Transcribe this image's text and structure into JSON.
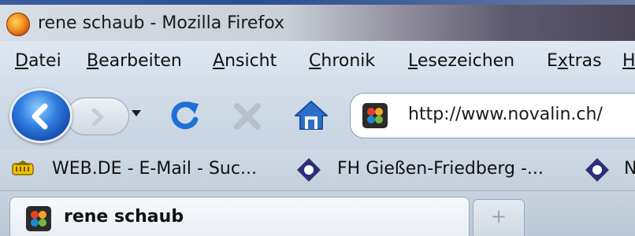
{
  "window": {
    "title": "rene schaub - Mozilla Firefox"
  },
  "menu": [
    {
      "accel": "D",
      "rest": "atei"
    },
    {
      "accel": "B",
      "rest": "earbeiten"
    },
    {
      "accel": "A",
      "rest": "nsicht"
    },
    {
      "accel": "C",
      "rest": "hronik"
    },
    {
      "accel": "L",
      "rest": "esezeichen"
    },
    {
      "pre": "E",
      "accel": "x",
      "rest": "tras"
    },
    {
      "accel": "H",
      "rest": ""
    }
  ],
  "navigation": {
    "url": "http://www.novalin.ch/"
  },
  "bookmarks": [
    {
      "label": "WEB.DE - E-Mail - Suc...",
      "icon": "webde-icon"
    },
    {
      "label": "FH Gießen-Friedberg -...",
      "icon": "fh-diamond-icon"
    },
    {
      "label": "N",
      "icon": "fh-diamond-icon"
    }
  ],
  "tabs": [
    {
      "label": "rene schaub",
      "active": true
    }
  ],
  "new_tab_symbol": "+",
  "colors": {
    "accent_blue": "#1f6fd6",
    "stop_gray": "#b9c0c9"
  }
}
